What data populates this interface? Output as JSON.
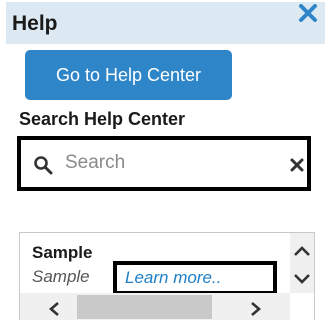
{
  "panel": {
    "title": "Help",
    "close_icon": "close-icon"
  },
  "help_center_button": {
    "label": "Go to Help Center"
  },
  "search": {
    "heading": "Search Help Center",
    "placeholder": "Search",
    "value": "",
    "icon": "search-icon",
    "clear_icon": "clear-icon"
  },
  "results": [
    {
      "title": "Sample",
      "description": "Sample",
      "link_label": "Learn more.."
    }
  ],
  "colors": {
    "header_bg": "#dde9f2",
    "close_icon": "#2e86c9",
    "button_bg": "#2e86c9",
    "button_text": "#ffffff",
    "link": "#1f7fc6",
    "highlight_border": "#000000"
  }
}
